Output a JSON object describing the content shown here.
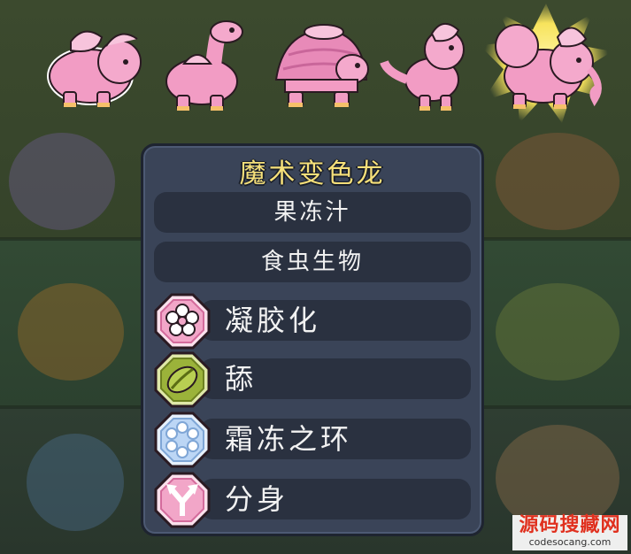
{
  "creatures": [
    {
      "name": "triceratops",
      "selected": false
    },
    {
      "name": "brontosaurus",
      "selected": false
    },
    {
      "name": "turtle",
      "selected": false
    },
    {
      "name": "raptor",
      "selected": false
    },
    {
      "name": "elephant",
      "selected": true
    }
  ],
  "panel": {
    "title": "魔术变色龙",
    "traits": [
      "果冻汁",
      "食虫生物"
    ],
    "abilities": [
      {
        "label": "凝胶化",
        "icon": "flower-icon",
        "color": "#f2a6c8"
      },
      {
        "label": "舔",
        "icon": "leaf-icon",
        "color": "#9bb33a"
      },
      {
        "label": "霜冻之环",
        "icon": "snowflake-ring-icon",
        "color": "#bcd6f5"
      },
      {
        "label": "分身",
        "icon": "split-arrow-icon",
        "color": "#f2a6c8"
      }
    ]
  },
  "watermark": {
    "main": "源码搜藏网",
    "sub": "codesocang.com"
  },
  "colors": {
    "title": "#f6e07a",
    "panel": "#3a4458",
    "creature_pink": "#f29cc4"
  }
}
